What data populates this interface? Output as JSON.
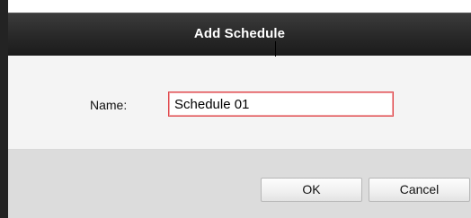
{
  "dialog": {
    "title": "Add Schedule"
  },
  "form": {
    "name_label": "Name:",
    "name_value": "Schedule 01"
  },
  "buttons": {
    "ok_label": "OK",
    "cancel_label": "Cancel"
  },
  "colors": {
    "title_bar": "#2a2a2a",
    "input_focus_border": "#e0464a",
    "footer_bg": "#dcdcdc"
  }
}
